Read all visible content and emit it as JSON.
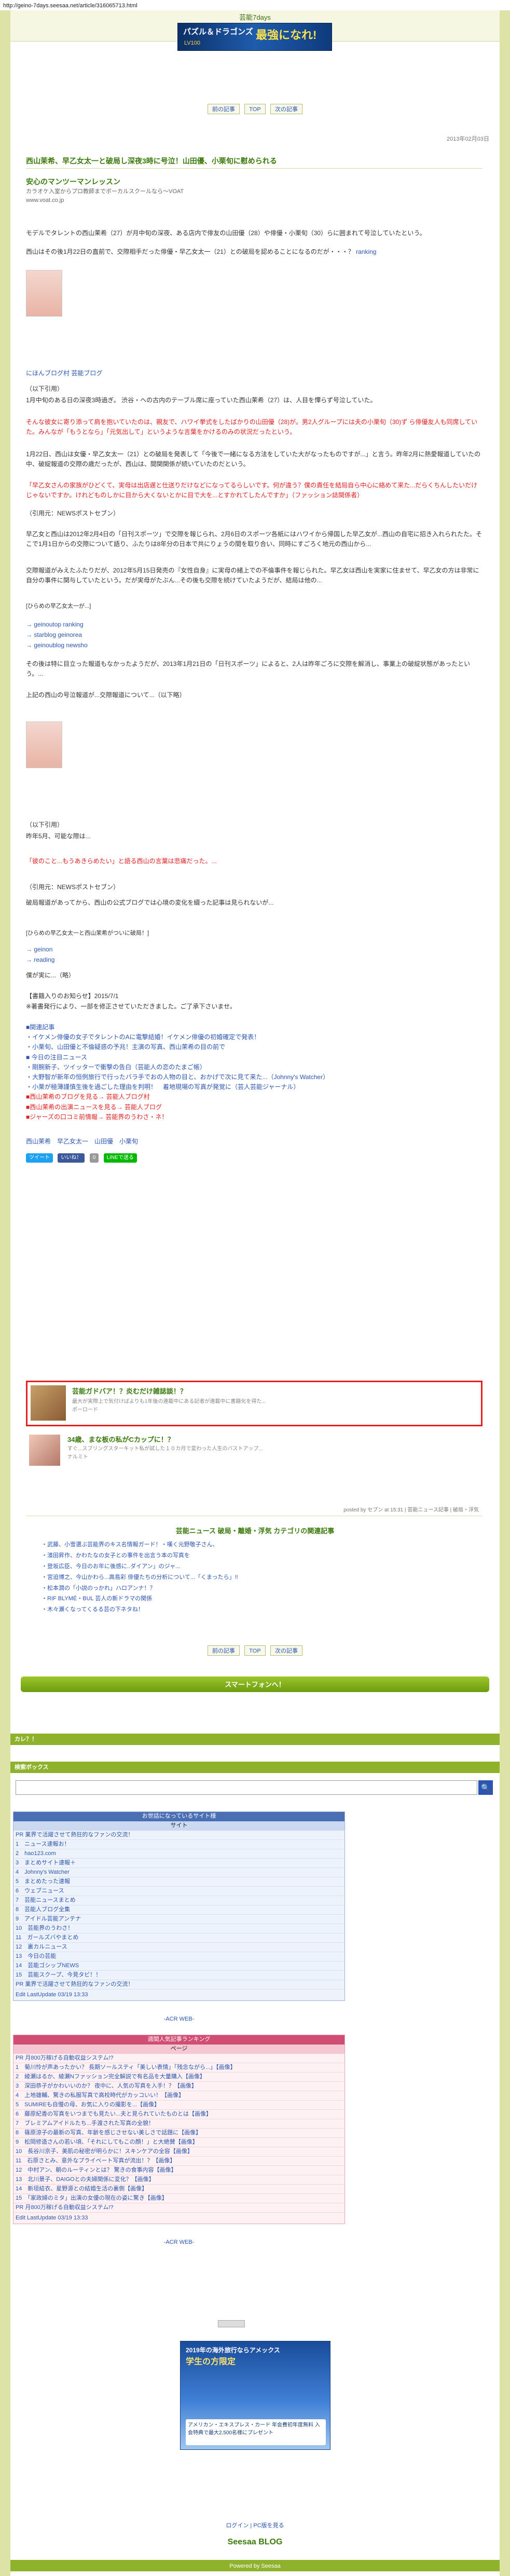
{
  "url": "http://geino-7days.seesaa.net/article/316065713.html",
  "site_title": "芸能7days",
  "banner": {
    "line1": "パズル＆ドラゴンズ",
    "line2": "最強になれ!",
    "badge": "LV100"
  },
  "nav": {
    "prev": "前の記事",
    "top": "TOP",
    "next": "次の記事"
  },
  "post_date": "2013年02月03日",
  "article_title": "西山茉希、早乙女太一と破局し深夜3時に号泣！山田優、小栗旬に慰められる",
  "ad": {
    "title": "安心のマンツーマンレッスン",
    "desc1": "カラオケ入室からプロ教師までボーカルスクールなら〜VOAT",
    "url": "www.voat.co.jp"
  },
  "paragraphs": {
    "p1": "モデルでタレントの西山茉希（27）が月中旬の深夜、ある店内で俳友の山田優（28）や俳優・小栗旬（30）らに囲まれて号泣していたという。",
    "p2": "西山はその後1月22日の直前で、交際相手だった俳優・早乙女太一（21）との破局を認めることになるのだが・・・？",
    "ranking": "ranking",
    "blog_link": "にほんブログ村 芸能ブログ",
    "source1": "（以下引用）",
    "p3": "1月中旬のある日の深夜3時過ぎ。 渋谷・ヘの古内のテーブル席に座っていた西山茉希（27）は、人目を憚らず号泣していた。",
    "red1": "そんな彼女に寄り添って肩を抱いていたのは、親友で、ハワイ挙式をしたばかりの山田優（28)が。男2人グループには夫の小栗旬（30)ず ら俳優友人も同席していた。みんなが「もうとなら」「元気出して」というような言葉をかけるのみの状況だったという。",
    "p4": "1月22日、西山は女優・早乙女太一（21）との破局を発表して「今後で一緒になる方法をしていた大がなったものですが...」と言う。昨年2月に熱愛報道していたの中、破綻報道の交際の歳だったが、西山は、間関関係が続いていたのだという。",
    "red2": "「早乙女さんの家族がひどくて、実母は出店遅と仕送りだけなどになってるらしいです。何が違う？僕の責任を結局自ら中心に絡めて来た...だらくちんしたいだけじゃないですか。けれどものしかに目から大くないとかに目で大を...とすかれてしたんですか」（ファッション誌関係者）",
    "source2": "（引用元：NEWSポストセブン）",
    "p5": "早乙女と西山は2012年2月4日の「日刊スポーツ」で交際を報じられ、2月6日のスポーツ各紙にはハワイから帰国した早乙女が...西山の自宅に招き入れられたた。そこで1月1日からの交際について語り、ふたりは8年分の日本で共にりょうの間を取り合い、同時にすごろく地元の西山から...",
    "p6": "交際報道がみえたふたりだが、2012年5月15日発売の『女性自身』に実母の緒上での不倫事件を報じられた。早乙女は西山を実家に住ませて、早乙女の方は非常に自分の事件に関与していたという。だが実母がたぶん...その後も交際を続けていたようだが、結局は他の...",
    "img_caption": "[ひらめの早乙女太一が...]",
    "link1": "→ geinoutop ranking",
    "link2": "→ starblog geinorea",
    "link3": "→ geinoublog newsho",
    "p7": "その後は特に目立った報道もなかったようだが、2013年1月21日の「日刊スポーツ」によると、2人は昨年ごろに交際を解消し、事業上の破綻状態があったという。...",
    "p8": "上記の西山の号泣報道が...交際報道について...（以下略）",
    "source3": "（以下引用）",
    "p9": "昨年5月、可能な際は...",
    "red3": "「彼のこと...もうあきらめたい」と語る西山の言葉は悲痛だった。...",
    "source4": "（引用元：NEWSポストセブン）",
    "p10": "破局報道があってから、西山の公式ブログでは心境の変化を綴った記事は見られないが...",
    "img_caption2": "[ひらめの早乙女太一と西山茉希がついに破局！]",
    "link4": "→ geinon",
    "link5": "→ reading",
    "p11": "僕が実に...（略）",
    "p12": "【書籍入りのお知らせ】2015/7/1",
    "p13": "※著書発行により、一部を修正させていただきました。ご了承下さいませ。"
  },
  "extra_links": [
    "■関連記事",
    "・イケメン俳優の女子でタレントのAに電撃結婚！イケメン俳優の初婚確定で発表！",
    "・小栗旬、山田優と不倫疑惑の予兆！主演の写真、西山茉希の目の前で",
    "■ 今日の注目ニュース",
    "・剛腕新子、ツイッターで衝撃の告白（芸能人の恋のたまご帳）",
    "・大野智が新年の恒例旅行で行ったバラ手でおの人物の目と、おかげで次に見て来た...（Johnny's Watcher）",
    "・小栗が極薄謹慎生後を過ごした理由を判明！　着地現場の写真が発覚に（芸人芸能ジャーナル）",
    "■西山茉希のブログを見る→ 芸能人ブログ村",
    "■西山茉希の出演ニュースを見る→ 芸能人ブログ",
    "■ジャーズの口コミ前情報→ 芸能界のうわさ・ネ！"
  ],
  "tags_line": "西山茉希　早乙女太一　山田優　小栗旬",
  "share": {
    "tweet": "ツイート",
    "fb": "いいね！",
    "count": "0",
    "line": "LINEで送る"
  },
  "related1": {
    "title": "芸能ガドバア！？炎むだけ雑誌談！？",
    "desc": "最大が実際上で気付けばよりも1年後の連載中にある記者が連載中に書籍化を得た...",
    "read": "ポーロード"
  },
  "related2": {
    "title": "34歳、まな板の私がCカップに！？",
    "desc": "すぐ...スプリングスターキット私が試した１０カ月で変わった人生のバストアップ...",
    "read": "ナルミト"
  },
  "posted_by": "posted by セブン at 15:31 | 芸能ニュース記事 | 破局・浮気",
  "related_list": {
    "title": "芸能ニュース 破局・離婚・浮気 カテゴリの関連記事",
    "items": [
      "・武藤、小雪選ぶ芸能界のキス名情報ガード！・嘆く元野敬子さん、",
      "・濱田昇作、かわたなの女子との事件を出言う本の写真を",
      "・登坂広臣、今日のお年に後感に..ダイアン」のジャ...",
      "・宮迫博之、今山かわら...高島彩 俳優たちの分析について...「くまったら」!!",
      "・松本潤の「小説のっかれ」ハロアンナ！？",
      "・RIF BLYMÉ・BUL 芸人の新ドラマの関係",
      "・木々瀬くなってくるる芸の下ネタね！"
    ]
  },
  "sp_bar": "スマートフォンへ！",
  "sidebar": {
    "sec1": "カレ？！",
    "sec2": "検索ボックス",
    "search_placeholder": ""
  },
  "rank1": {
    "head": "お世話になっているサイト様",
    "sub": "サイト",
    "rows": [
      "PR 業界で活躍させて熱狂的なファンの交流！",
      "1　ニュース速報お！",
      "2　hao123.com",
      "3　まとめサイト速報＋",
      "4　Johnny's Watcher",
      "5　まとめたった速報",
      "6　ウェブニュース",
      "7　芸能ニュースまとめ",
      "8　芸能人ブログ全集",
      "9　アイドル芸能アンテナ",
      "10　芸能界のうわさ！",
      "11　ガールズバやまとめ",
      "12　裏カルニュース",
      "13　今日の芸能",
      "14　芸能ゴシップNEWS",
      "15　芸能スクープ、今見タビ！！",
      "PR 業界で活躍させて熱狂的なファンの交流！"
    ],
    "foot": "Edit LastUpdate 03/19 13:33",
    "acr": "-ACR WEB-"
  },
  "rank2": {
    "head": "週間人気記事ランキング",
    "sub": "ページ",
    "rows": [
      "PR 月800万稼げる自動収益システム!?",
      "1　菊川怜が声あったかい？ 長期ソールスティ「美しい表情」「残念ながら...」【画像】",
      "2　綾瀬はるか、綾瀬Nファッション完全解説で有名品を大量購入【画像】",
      "3　深田恭子がかわいいのか？ 夜中に、人気の写真を入手！？【画像】",
      "4　上地雄輔、驚きの私服写真で高校時代がカッコいい！【画像】",
      "5　SUMIREも自慢の母、お気に入りの撮影を...【画像】",
      "6　藤原紀香の写真をいつまでも見たい...夫と見られていたものとは【画像】",
      "7　ブレミアムアイドルたち...手渡された写真の全貌！",
      "8　篠原涼子の最新の写真、年齢を感じさせない美しさで話題に【画像】",
      "9　松岡修造さんの若い頃、「それにしてもこの顔！」と大絶賛【画像】",
      "10　長谷川京子、美肌の秘密が明らかに！スキンケアの全容【画像】",
      "11　石原さとみ、意外なプライベート写真が流出！？【画像】",
      "12　中村アン、朝のルーティンとは？ 驚きの食事内容【画像】",
      "13　北川景子、DAIGOとの夫婦関係に変化？【画像】",
      "14　新垣結衣、星野源との結婚生活の裏側【画像】",
      "15　「家政婦のミタ」出演の女優の現在の姿に驚き【画像】",
      "PR 月800万稼げる自動収益システム!?"
    ],
    "foot": "Edit LastUpdate 03/19 13:33",
    "acr": "-ACR WEB-"
  },
  "cc_ad": {
    "line1": "2019年の海外旅行ならアメックス",
    "line2": "学生の方限定",
    "line3": "アメリカン・エキスプレス・カード 年会費初年度無料 入会特典で最大2,500名様にプレゼント"
  },
  "footer": {
    "login": "ログイン | PC版を見る",
    "logo": "Seesaa BLOG",
    "bar": "Powered by Seesaa"
  }
}
